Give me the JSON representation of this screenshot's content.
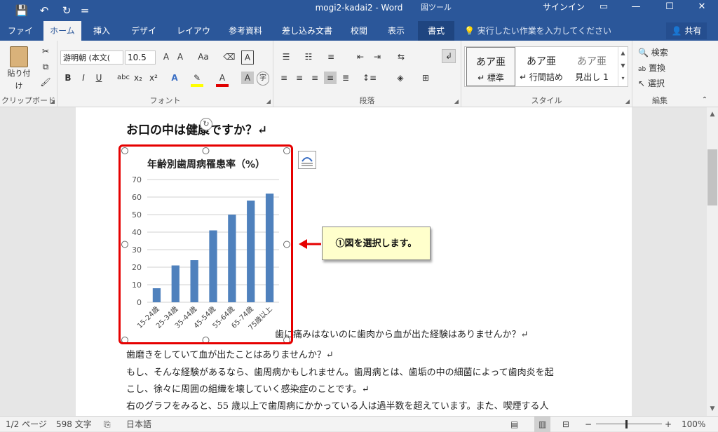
{
  "window": {
    "title": "mogi2-kadai2 - Word",
    "context_tools": "図ツール",
    "sign_in": "サインイン",
    "qa_save": "💾",
    "qa_undo": "↶",
    "qa_redo": "↻",
    "qa_more": "=",
    "wc_ribbon": "▭",
    "wc_min": "—",
    "wc_max": "☐",
    "wc_close": "✕"
  },
  "tabs": [
    "ファイル",
    "ホーム",
    "挿入",
    "デザイン",
    "レイアウト",
    "参考資料",
    "差し込み文書",
    "校閲",
    "表示",
    "書式"
  ],
  "tell_me": "実行したい作業を入力してください",
  "share": "共有",
  "ribbon": {
    "clipboard": {
      "paste": "貼り付け",
      "label": "クリップボード"
    },
    "font": {
      "name": "游明朝 (本文(",
      "size": "10.5",
      "label": "フォント"
    },
    "paragraph": {
      "label": "段落"
    },
    "styles": {
      "items": [
        {
          "preview": "あア亜",
          "name": "↵ 標準"
        },
        {
          "preview": "あア亜",
          "name": "↵ 行間詰め"
        },
        {
          "preview": "あア亜",
          "name": "見出し 1"
        }
      ],
      "label": "スタイル"
    },
    "editing": {
      "find": "検索",
      "replace": "置換",
      "select": "選択",
      "label": "編集"
    }
  },
  "document": {
    "heading": "お口の中は健康ですか？↵",
    "lines": [
      "歯に痛みはないのに歯肉から血が出た経験はありませんか？↵",
      "歯磨きをしていて血が出たことはありませんか？↵",
      "もし、そんな経験があるなら、歯周病かもしれません。歯周病とは、歯垢の中の細菌によって歯肉炎を起",
      "こし、徐々に周囲の組織を壊していく感染症のことです。↵",
      "右のグラフをみると、55 歳以上で歯周病にかかっている人は過半数を超えています。また、喫煙する人"
    ]
  },
  "callout": "①図を選択します。",
  "chart_data": {
    "type": "bar",
    "title": "年齢別歯周病罹患率（%）",
    "categories": [
      "15-24歳",
      "25-34歳",
      "35-44歳",
      "45-54歳",
      "55-64歳",
      "65-74歳",
      "75歳以上"
    ],
    "values": [
      8,
      21,
      24,
      41,
      50,
      58,
      62
    ],
    "ylim": [
      0,
      70
    ],
    "yticks": [
      0,
      10,
      20,
      30,
      40,
      50,
      60,
      70
    ],
    "grid": true,
    "color": "#4f81bd"
  },
  "status": {
    "page": "1/2 ページ",
    "words": "598 文字",
    "lang": "日本語",
    "zoom": "100%"
  },
  "colors": {
    "accent": "#2b579a",
    "selection": "#e60000",
    "callout_bg": "#ffffcc"
  }
}
